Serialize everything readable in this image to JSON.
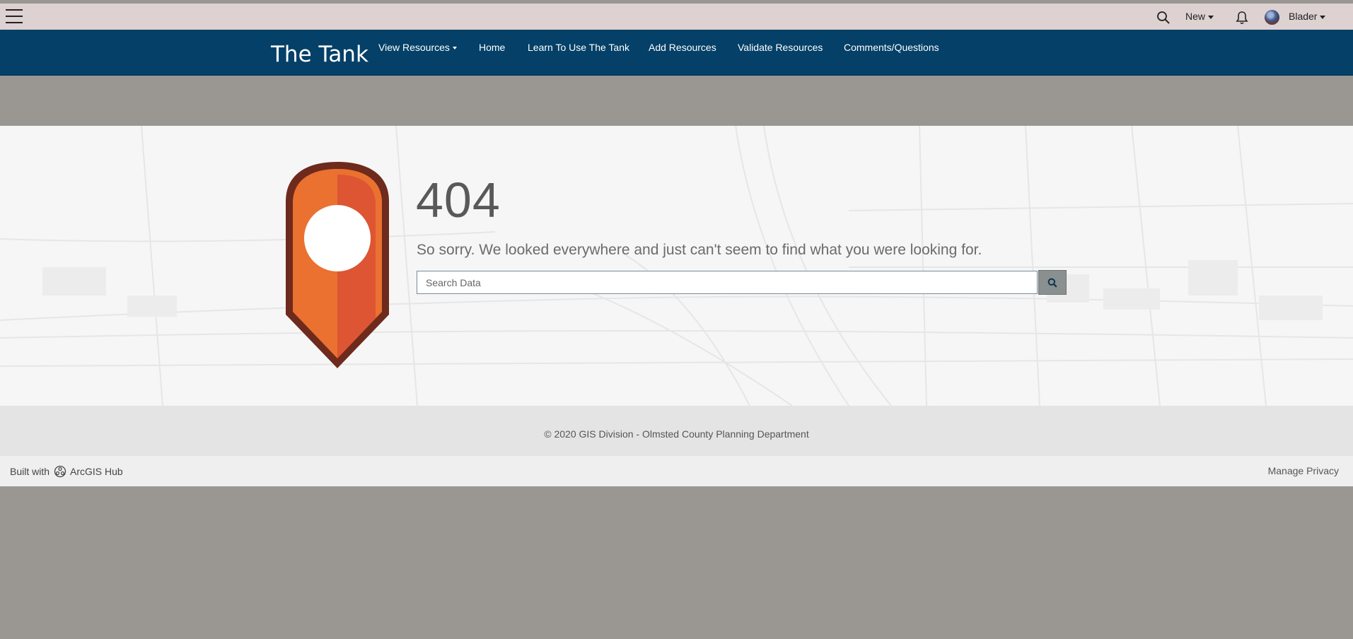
{
  "topbar": {
    "new_label": "New",
    "user_name": "Blader",
    "icons": [
      "hamburger-menu-icon",
      "search-icon",
      "bell-icon",
      "avatar"
    ]
  },
  "site": {
    "title": "The Tank",
    "nav": [
      {
        "label": "View Resources",
        "has_dropdown": true
      },
      {
        "label": "Home"
      },
      {
        "label": "Learn To Use The Tank"
      },
      {
        "label": "Add Resources"
      },
      {
        "label": "Validate Resources"
      },
      {
        "label": "Comments/Questions"
      }
    ]
  },
  "error": {
    "code": "404",
    "message": "So sorry. We looked everywhere and just can't seem to find what you were looking for.",
    "search_placeholder": "Search Data"
  },
  "footer": {
    "copyright": "© 2020 GIS Division - Olmsted County Planning Department"
  },
  "hub": {
    "built_with": "Built with",
    "brand": "ArcGIS Hub",
    "privacy": "Manage Privacy"
  },
  "colors": {
    "nav_bg": "#044067",
    "topbar_bg": "#ddd1d1",
    "pin_orange": "#ea7130",
    "pin_red": "#dd5533",
    "pin_outline": "#6e2a1c",
    "page_bg": "#9a9792"
  }
}
